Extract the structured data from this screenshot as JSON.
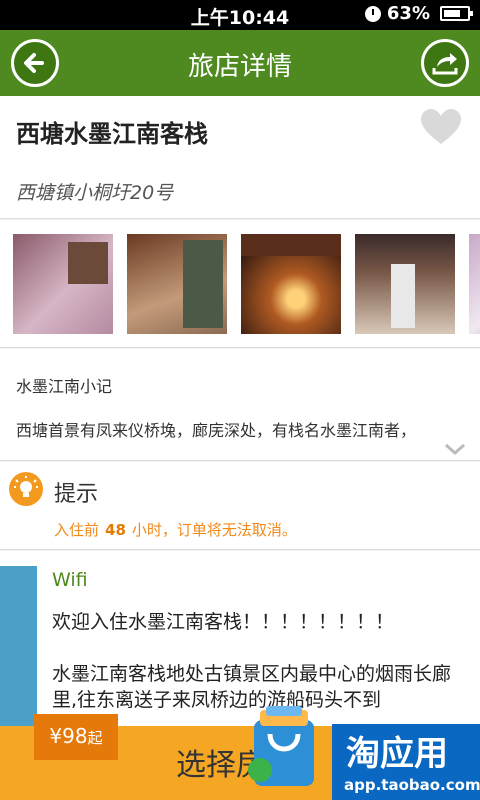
{
  "status": {
    "time": "上午10:44",
    "battery": "63%"
  },
  "header": {
    "title": "旅店详情"
  },
  "hotel": {
    "name": "西塘水墨江南客栈",
    "address": "西塘镇小桐圩20号"
  },
  "description": {
    "heading": "水墨江南小记",
    "body": "西塘首景有凤来仪桥堍，廊庑深处，有栈名水墨江南者，"
  },
  "tips": {
    "label": "提示",
    "note_before": "入住前",
    "hours": "48",
    "note_after": "小时，订单将无法取消。"
  },
  "facility": {
    "name": "Wifi",
    "text": "欢迎入住水墨江南客栈！！！！！！！！\n\n水墨江南客栈地处古镇景区内最中心的烟雨长廊里,往东离送子来凤桥边的游船码头不到"
  },
  "bottom": {
    "price": "¥98",
    "price_suffix": "起",
    "select_label": "选择房"
  },
  "ad": {
    "title": "淘应用",
    "url": "app.taobao.com"
  },
  "colors": {
    "header": "#4e8a1f",
    "accent": "#f5a623",
    "tip": "#f08a1a"
  },
  "icons": [
    "back-icon",
    "share-icon",
    "heart-icon",
    "lightbulb-icon",
    "chevron-down-icon"
  ]
}
